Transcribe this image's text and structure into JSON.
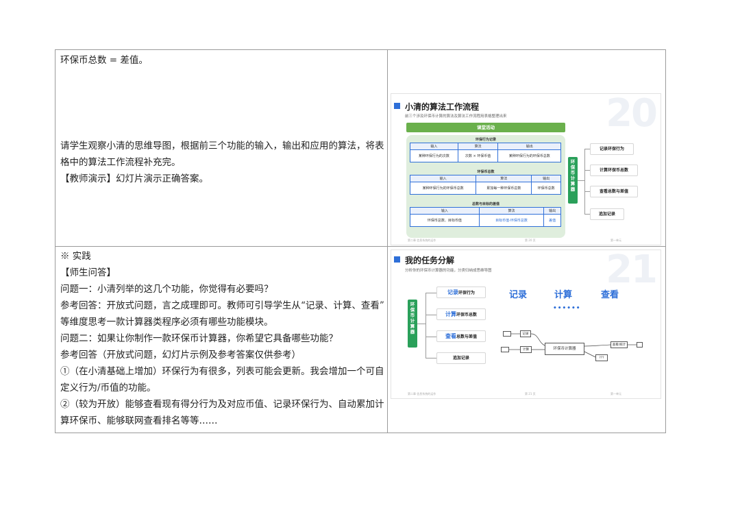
{
  "left_top": {
    "line1": "环保币总数 = 差值。",
    "line2": "请学生观察小清的思维导图，根据前三个功能的输入，输出和应用的算法，将表",
    "line3": "格中的算法工作流程补充完。",
    "line4": "【教师演示】幻灯片演示正确答案。"
  },
  "left_bottom": {
    "lines": [
      "※  实践",
      "【师生问答】",
      "问题一：小清列举的这几个功能，你觉得有必要吗？",
      "参考回答：开放式问题，言之成理即可。教师可引导学生从“记录、计算、查看”",
      "等维度思考一款计算器类程序必须有哪些功能模块。",
      "问题二：如果让你制作一款环保币计算器，你希望它具备哪些功能？",
      "参考回答（开放式问题，幻灯片示例及参考答案仅供参考）",
      "①（在小清基础上增加）环保行为有很多，列表可能会更新。我会增加一个可自",
      "定义行为/币值的功能。",
      "②（较为开放）能够查看现有得分行为及对应币值、记录环保行为、自动累加计",
      "算环保币、能够联网查看排名等等……"
    ]
  },
  "slide20": {
    "number": "20",
    "title": "小清的算法工作流程",
    "subtitle": "前三个涉及环保币计算的算法及算法工作流程用表格整理出来",
    "bar": "课堂活动",
    "blocks": [
      {
        "title": "环保行为记录",
        "headers": [
          "输入",
          "算法",
          "输出"
        ],
        "row": [
          "某种环保行为的次数",
          "次数 × 环保币值",
          "某种环保行为的环保币总数"
        ]
      },
      {
        "title": "环保币总数",
        "headers": [
          "输入",
          "算法",
          "输出"
        ],
        "row": [
          "某种环保行为的环保币总数",
          "累加每一种环保币总数",
          "环保币总数"
        ]
      },
      {
        "title": "总数与目标的差值",
        "headers": [
          "输入",
          "算法",
          "输出"
        ],
        "row": [
          "环保币总数、目标币值",
          "目标币值-环保币总数",
          "差值"
        ]
      }
    ],
    "calculator": "环保币计算器",
    "functions": [
      "记录环保行为",
      "计算环保币总数",
      "查看总数与差值",
      "追加记录"
    ],
    "footer": [
      "第二章 信息系统的运作",
      "第 20 页",
      "第一单元"
    ]
  },
  "slide21": {
    "number": "21",
    "title": "我的任务分解",
    "subtitle": "分析你的环保币计算器的功能，分类归纳成思维导图",
    "calculator": "环保币计算器",
    "items": [
      {
        "highlight": "记录",
        "rest": "环保行为"
      },
      {
        "highlight": "计算",
        "rest": "环保币总数"
      },
      {
        "highlight": "查看",
        "rest": "总数与差值"
      },
      {
        "highlight": "",
        "rest": "追加记录"
      }
    ],
    "categories": [
      "记录",
      "计算",
      "查看"
    ],
    "dots": "••••••",
    "diagram": {
      "record": "记录",
      "calc": "计算",
      "center": "环保币计算器",
      "view": "查看/统计",
      "unknown": "???"
    },
    "footer": [
      "第二章 信息系统的运作",
      "第 21 页",
      "第一单元"
    ]
  }
}
